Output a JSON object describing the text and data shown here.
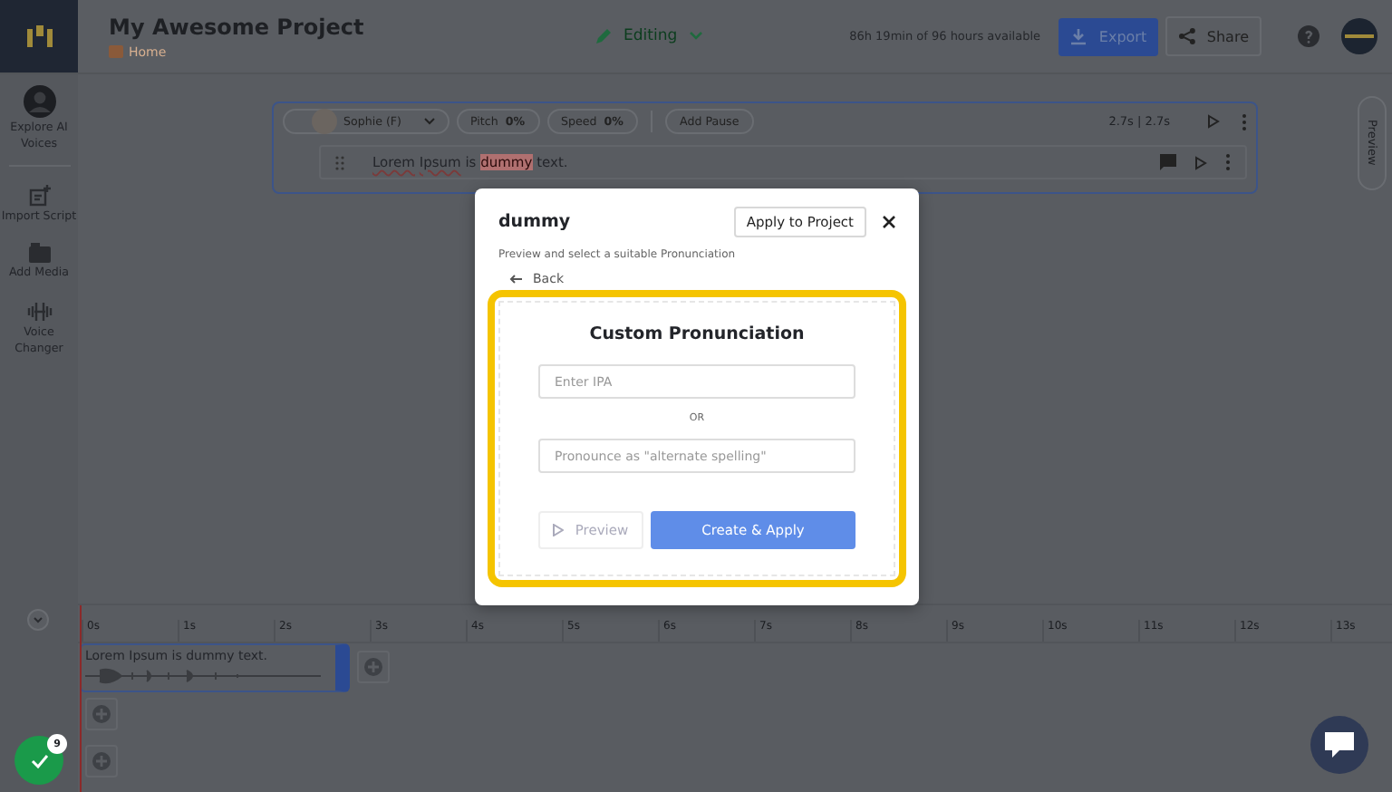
{
  "header": {
    "project_title": "My Awesome Project",
    "breadcrumb": "Home",
    "mode": "Editing",
    "usage": "86h 19min of 96 hours available",
    "export_button": "Export",
    "share_button": "Share"
  },
  "sidebar": {
    "items": [
      {
        "label": "Explore AI Voices",
        "kind": "avatar"
      },
      {
        "label": "Import Script",
        "kind": "import"
      },
      {
        "label": "Add Media",
        "kind": "media"
      },
      {
        "label": "Voice Changer",
        "kind": "changer"
      }
    ]
  },
  "block": {
    "voice": "Sophie (F)",
    "pitch_label": "Pitch",
    "pitch_value": "0%",
    "speed_label": "Speed",
    "speed_value": "0%",
    "add_pause": "Add Pause",
    "duration": "2.7s | 2.7s",
    "words": [
      {
        "text": "Lorem",
        "kind": "underlined"
      },
      {
        "text": "Ipsum",
        "kind": "underlined"
      },
      {
        "text": "is",
        "kind": "plain"
      },
      {
        "text": "dummy",
        "kind": "highlighted"
      },
      {
        "text": "text.",
        "kind": "plain"
      }
    ]
  },
  "preview_tab": "Preview",
  "modal": {
    "title": "dummy",
    "apply_button": "Apply to Project",
    "subtitle": "Preview and select a suitable Pronunciation",
    "back": "Back",
    "heading": "Custom Pronunciation",
    "ipa_placeholder": "Enter IPA",
    "separator": "OR",
    "spelling_placeholder": "Pronounce as \"alternate spelling\"",
    "preview_button": {
      "label": "Preview",
      "disabled": true
    },
    "create_button": {
      "label": "Create & Apply",
      "disabled": true
    }
  },
  "timeline": {
    "ticks": [
      "0s",
      "1s",
      "2s",
      "3s",
      "4s",
      "5s",
      "6s",
      "7s",
      "8s",
      "9s",
      "10s",
      "11s",
      "12s",
      "13s"
    ],
    "clip_text": "Lorem Ipsum is dummy text.",
    "badge_count": "9"
  }
}
